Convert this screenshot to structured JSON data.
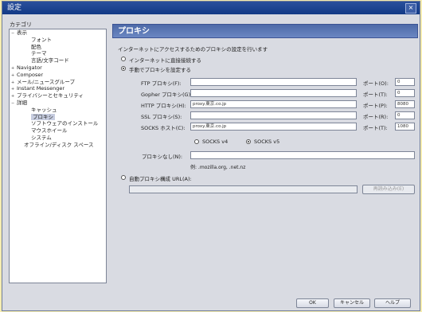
{
  "window": {
    "title": "設定",
    "close_glyph": "×"
  },
  "sidebar": {
    "label": "カテゴリ",
    "items": [
      {
        "label": "表示",
        "toggle": "−",
        "indent": 0
      },
      {
        "label": "フォント",
        "toggle": "",
        "indent": 2
      },
      {
        "label": "配色",
        "toggle": "",
        "indent": 2
      },
      {
        "label": "テーマ",
        "toggle": "",
        "indent": 2
      },
      {
        "label": "言語/文字コード",
        "toggle": "",
        "indent": 2
      },
      {
        "label": "Navigator",
        "toggle": "+",
        "indent": 0
      },
      {
        "label": "Composer",
        "toggle": "+",
        "indent": 0
      },
      {
        "label": "メール/ニュースグループ",
        "toggle": "+",
        "indent": 0
      },
      {
        "label": "Instant Messenger",
        "toggle": "+",
        "indent": 0
      },
      {
        "label": "プライバシーとセキュリティ",
        "toggle": "+",
        "indent": 0
      },
      {
        "label": "詳細",
        "toggle": "−",
        "indent": 0
      },
      {
        "label": "キャッシュ",
        "toggle": "",
        "indent": 2
      },
      {
        "label": "プロキシ",
        "toggle": "",
        "indent": 2,
        "selected": true
      },
      {
        "label": "ソフトウェアのインストール",
        "toggle": "",
        "indent": 2
      },
      {
        "label": "マウスホイール",
        "toggle": "",
        "indent": 2
      },
      {
        "label": "システム",
        "toggle": "",
        "indent": 2
      },
      {
        "label": "オフライン/ディスク スペース",
        "toggle": "",
        "indent": 1
      }
    ]
  },
  "panel": {
    "title": "プロキシ",
    "description": "インターネットにアクセスするためのプロキシの設定を行います",
    "direct": {
      "label": "インターネットに直接接続する",
      "checked": false
    },
    "manual": {
      "label": "手動でプロキシを設定する",
      "checked": true
    },
    "fields": [
      {
        "label": "FTP プロキシ(F):",
        "value": "",
        "port_label": "ポート(O):",
        "port": "0"
      },
      {
        "label": "Gopher プロキシ(G):",
        "value": "",
        "port_label": "ポート(T):",
        "port": "0"
      },
      {
        "label": "HTTP プロキシ(H):",
        "value": "proxy.東京.co.jp",
        "port_label": "ポート(P):",
        "port": "8080"
      },
      {
        "label": "SSL プロキシ(S):",
        "value": "",
        "port_label": "ポート(R):",
        "port": "0"
      },
      {
        "label": "SOCKS ホスト(C):",
        "value": "proxy.東京.co.jp",
        "port_label": "ポート(T):",
        "port": "1080"
      }
    ],
    "socks_v4": {
      "label": "SOCKS v4",
      "checked": false
    },
    "socks_v5": {
      "label": "SOCKS v5",
      "checked": true
    },
    "noproxy_label": "プロキシなし(N):",
    "noproxy_value": "",
    "noproxy_example": "例: .mozilla.org, .net.nz",
    "auto": {
      "label": "自動プロキシ構成 URL(A):",
      "checked": false
    },
    "auto_value": "",
    "reload_label": "再読み込み(E)"
  },
  "footer": {
    "ok": "OK",
    "cancel": "キャンセル",
    "help": "ヘルプ"
  }
}
